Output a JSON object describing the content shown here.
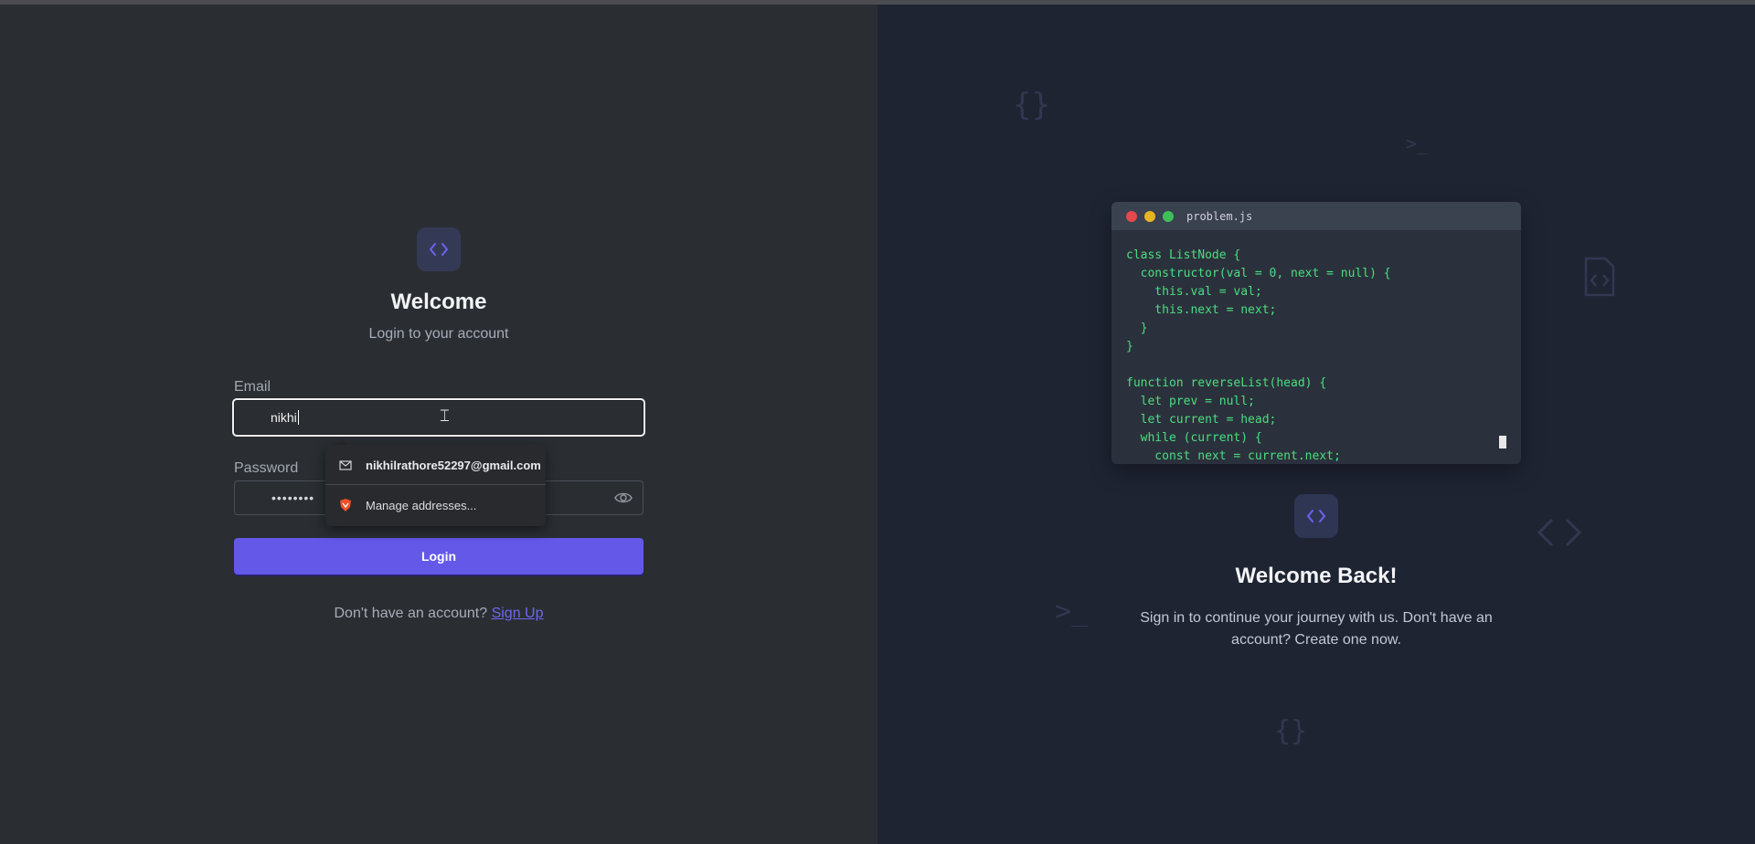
{
  "login": {
    "title": "Welcome",
    "subtitle": "Login to your account",
    "email_label": "Email",
    "email_value": "nikhi",
    "password_label": "Password",
    "password_value": "••••••••",
    "login_label": "Login",
    "signup_prompt": "Don't have an account?",
    "signup_link": "Sign Up"
  },
  "autofill": {
    "suggestion": "nikhilrathore52297@gmail.com",
    "manage": "Manage addresses..."
  },
  "code_window": {
    "filename": "problem.js",
    "code": "class ListNode {\n  constructor(val = 0, next = null) {\n    this.val = val;\n    this.next = next;\n  }\n}\n\nfunction reverseList(head) {\n  let prev = null;\n  let current = head;\n  while (current) {\n    const next = current.next;",
    "dots": [
      "#e5484d",
      "#e6b422",
      "#3fbf5a"
    ]
  },
  "right": {
    "title": "Welcome Back!",
    "subtitle": "Sign in to continue your journey with us. Don't have an account? Create one now."
  },
  "colors": {
    "accent": "#6358e8",
    "code_text": "#4ade80",
    "left_bg": "#2a2e33",
    "right_bg": "#1f2433"
  },
  "icons": {
    "logo": "code-brackets-icon",
    "eye": "eye-icon",
    "mail": "mail-icon",
    "manage": "shield-icon"
  }
}
